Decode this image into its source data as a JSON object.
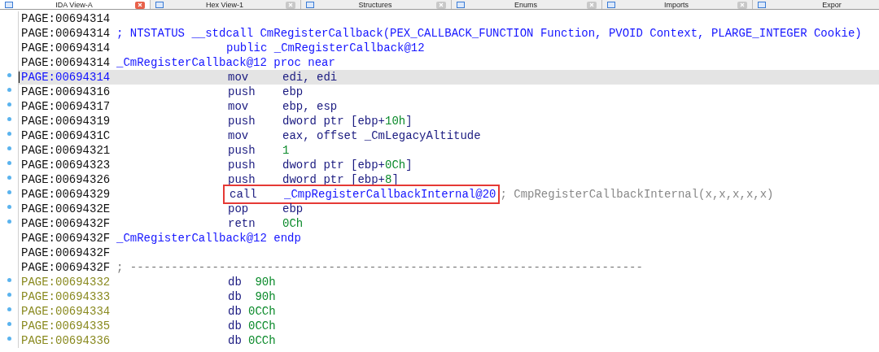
{
  "tabs": [
    {
      "label": "IDA View-A",
      "selected": true,
      "closable": true
    },
    {
      "label": "Hex View-1",
      "selected": false,
      "closable": true
    },
    {
      "label": "Structures",
      "selected": false,
      "closable": true
    },
    {
      "label": "Enums",
      "selected": false,
      "closable": true
    },
    {
      "label": "Imports",
      "selected": false,
      "closable": true
    },
    {
      "label": "Expor",
      "selected": false,
      "closable": false
    }
  ],
  "lines": [
    {
      "address": "PAGE:00694314",
      "kind": "code",
      "marked": false,
      "selected": false
    },
    {
      "address": "PAGE:00694314",
      "kind": "code",
      "marked": false,
      "selected": false,
      "header": "; NTSTATUS __stdcall CmRegisterCallback(PEX_CALLBACK_FUNCTION Function, PVOID Context, PLARGE_INTEGER Cookie)"
    },
    {
      "address": "PAGE:00694314",
      "kind": "code",
      "marked": false,
      "selected": false,
      "directive": "public _CmRegisterCallback@12"
    },
    {
      "address": "PAGE:00694314",
      "kind": "code",
      "marked": false,
      "selected": false,
      "header": "_CmRegisterCallback@12 proc near"
    },
    {
      "address": "PAGE:00694314",
      "kind": "code",
      "marked": true,
      "selected": true,
      "boxed": false,
      "mnemonic": "mov",
      "operands": [
        {
          "text": "edi, edi",
          "kind": "plain"
        }
      ]
    },
    {
      "address": "PAGE:00694316",
      "kind": "code",
      "marked": true,
      "selected": false,
      "boxed": false,
      "mnemonic": "push",
      "operands": [
        {
          "text": "ebp",
          "kind": "plain"
        }
      ]
    },
    {
      "address": "PAGE:00694317",
      "kind": "code",
      "marked": true,
      "selected": false,
      "boxed": false,
      "mnemonic": "mov",
      "operands": [
        {
          "text": "ebp, esp",
          "kind": "plain"
        }
      ]
    },
    {
      "address": "PAGE:00694319",
      "kind": "code",
      "marked": true,
      "selected": false,
      "boxed": false,
      "mnemonic": "push",
      "operands": [
        {
          "text": "dword ptr [ebp+",
          "kind": "plain"
        },
        {
          "text": "10h",
          "kind": "number"
        },
        {
          "text": "]",
          "kind": "plain"
        }
      ]
    },
    {
      "address": "PAGE:0069431C",
      "kind": "code",
      "marked": true,
      "selected": false,
      "boxed": false,
      "mnemonic": "mov",
      "operands": [
        {
          "text": "eax, offset _CmLegacyAltitude",
          "kind": "plain"
        }
      ]
    },
    {
      "address": "PAGE:00694321",
      "kind": "code",
      "marked": true,
      "selected": false,
      "boxed": false,
      "mnemonic": "push",
      "operands": [
        {
          "text": "1",
          "kind": "number"
        }
      ]
    },
    {
      "address": "PAGE:00694323",
      "kind": "code",
      "marked": true,
      "selected": false,
      "boxed": false,
      "mnemonic": "push",
      "operands": [
        {
          "text": "dword ptr [ebp+",
          "kind": "plain"
        },
        {
          "text": "0Ch",
          "kind": "number"
        },
        {
          "text": "]",
          "kind": "plain"
        }
      ]
    },
    {
      "address": "PAGE:00694326",
      "kind": "code",
      "marked": true,
      "selected": false,
      "boxed": false,
      "mnemonic": "push",
      "operands": [
        {
          "text": "dword ptr [ebp+",
          "kind": "plain"
        },
        {
          "text": "8",
          "kind": "number"
        },
        {
          "text": "]",
          "kind": "plain"
        }
      ]
    },
    {
      "address": "PAGE:00694329",
      "kind": "code",
      "marked": true,
      "selected": false,
      "boxed": true,
      "mnemonic": "call",
      "operands": [
        {
          "text": "_CmpRegisterCallbackInternal@20",
          "kind": "name"
        }
      ],
      "comment": "; CmpRegisterCallbackInternal(x,x,x,x,x)"
    },
    {
      "address": "PAGE:0069432E",
      "kind": "code",
      "marked": true,
      "selected": false,
      "boxed": false,
      "mnemonic": "pop",
      "operands": [
        {
          "text": "ebp",
          "kind": "plain"
        }
      ]
    },
    {
      "address": "PAGE:0069432F",
      "kind": "code",
      "marked": true,
      "selected": false,
      "boxed": false,
      "mnemonic": "retn",
      "operands": [
        {
          "text": "0Ch",
          "kind": "number"
        }
      ]
    },
    {
      "address": "PAGE:0069432F",
      "kind": "code",
      "marked": false,
      "selected": false,
      "header": "_CmRegisterCallback@12 endp"
    },
    {
      "address": "PAGE:0069432F",
      "kind": "code",
      "marked": false,
      "selected": false
    },
    {
      "address": "PAGE:0069432F",
      "kind": "code",
      "marked": false,
      "selected": false,
      "separator": "; ---------------------------------------------------------------------------"
    },
    {
      "address": "PAGE:00694332",
      "kind": "data",
      "marked": true,
      "selected": false,
      "boxed": false,
      "mnemonic": "db",
      "operands": [
        {
          "text": " 90h",
          "kind": "number"
        }
      ]
    },
    {
      "address": "PAGE:00694333",
      "kind": "data",
      "marked": true,
      "selected": false,
      "boxed": false,
      "mnemonic": "db",
      "operands": [
        {
          "text": " 90h",
          "kind": "number"
        }
      ]
    },
    {
      "address": "PAGE:00694334",
      "kind": "data",
      "marked": true,
      "selected": false,
      "boxed": false,
      "mnemonic": "db",
      "operands": [
        {
          "text": "0CCh",
          "kind": "number"
        }
      ]
    },
    {
      "address": "PAGE:00694335",
      "kind": "data",
      "marked": true,
      "selected": false,
      "boxed": false,
      "mnemonic": "db",
      "operands": [
        {
          "text": "0CCh",
          "kind": "number"
        }
      ]
    },
    {
      "address": "PAGE:00694336",
      "kind": "data",
      "marked": true,
      "selected": false,
      "boxed": false,
      "mnemonic": "db",
      "operands": [
        {
          "text": "0CCh",
          "kind": "number"
        }
      ]
    }
  ]
}
